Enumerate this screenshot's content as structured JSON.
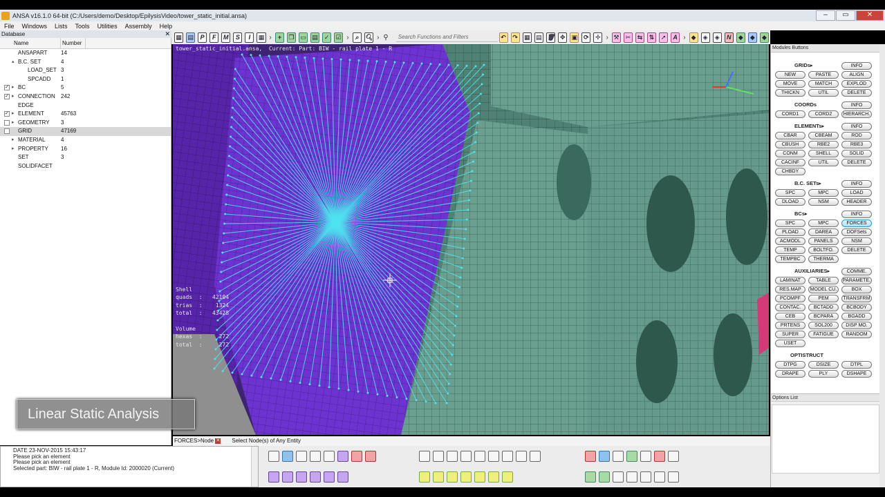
{
  "window": {
    "title": "ANSA v16.1.0 64-bit (C:/Users/demo/Desktop/EpilysisVideo/tower_static_initial.ansa)",
    "controls": [
      "–",
      "▭",
      "✕"
    ]
  },
  "menu": [
    "File",
    "Windows",
    "Lists",
    "Tools",
    "Utilities",
    "Assembly",
    "Help"
  ],
  "search": {
    "placeholder": "Search Functions and Filters"
  },
  "database": {
    "panel_title": "Database",
    "columns": [
      "Name",
      "Number"
    ],
    "rows": [
      {
        "name": "ANSAPART",
        "number": "14",
        "checked": null,
        "arrow": "",
        "indent": 1
      },
      {
        "name": "B.C. SET",
        "number": "4",
        "checked": null,
        "arrow": "▴",
        "indent": 1
      },
      {
        "name": "LOAD_SET",
        "number": "3",
        "checked": null,
        "arrow": "",
        "indent": 2
      },
      {
        "name": "SPCADD",
        "number": "1",
        "checked": null,
        "arrow": "",
        "indent": 2
      },
      {
        "name": "BC",
        "number": "5",
        "checked": true,
        "arrow": "▸",
        "indent": 1
      },
      {
        "name": "CONNECTION",
        "number": "242",
        "checked": true,
        "arrow": "▸",
        "indent": 1
      },
      {
        "name": "EDGE",
        "number": "",
        "checked": null,
        "arrow": "",
        "indent": 1
      },
      {
        "name": "ELEMENT",
        "number": "45763",
        "checked": true,
        "arrow": "▸",
        "indent": 1
      },
      {
        "name": "GEOMETRY",
        "number": "3",
        "checked": false,
        "arrow": "▸",
        "indent": 1
      },
      {
        "name": "GRID",
        "number": "47169",
        "checked": false,
        "arrow": "",
        "indent": 1,
        "selected": true
      },
      {
        "name": "MATERIAL",
        "number": "4",
        "checked": null,
        "arrow": "▸",
        "indent": 1
      },
      {
        "name": "PROPERTY",
        "number": "16",
        "checked": null,
        "arrow": "▸",
        "indent": 1
      },
      {
        "name": "SET",
        "number": "3",
        "checked": null,
        "arrow": "",
        "indent": 1
      },
      {
        "name": "SOLIDFACET",
        "number": "",
        "checked": null,
        "arrow": "",
        "indent": 1
      }
    ]
  },
  "viewport": {
    "header": "tower_static_initial.ansa,  Current: Part: BIW - rail plate 1 - R",
    "stats": [
      "Shell",
      "quads  :   42104",
      "trias  :    1324",
      "total  :   43428",
      "",
      "Volume",
      "hexas  :     272",
      "total  :     272"
    ],
    "caption": "Linear Static Analysis"
  },
  "status": {
    "mode": "FORCES>Node",
    "prompt": "Select Node(s) of Any Entity"
  },
  "messages": [
    "DATE 23-NOV-2015  15:43:17",
    "Please pick an element",
    "Please pick an element",
    "Selected part: BIW - rail plate 1 - R, Module Id: 2000020 (Current)"
  ],
  "modules": {
    "panel_title": "Modules Buttons",
    "options_title": "Options List",
    "sections": [
      {
        "title": "GRIDs▸",
        "buttons": [
          "INFO",
          "NEW",
          "PASTE",
          "ALIGN",
          "MOVE",
          "MATCH",
          "EXPLOD",
          "THICKN",
          "UTIL",
          "DELETE"
        ]
      },
      {
        "title": "COORDs",
        "buttons": [
          "INFO",
          "CORD1",
          "CORD2",
          "HIERARCH."
        ]
      },
      {
        "title": "ELEMENTs▸",
        "buttons": [
          "INFO",
          "CBAR",
          "CBEAM",
          "ROD",
          "CBUSH",
          "RBE2",
          "RBE3",
          "CONM",
          "SHELL",
          "SOLID",
          "CACINF",
          "UTIL",
          "DELETE",
          "CHBDY"
        ]
      },
      {
        "title": "B.C. SETs▸",
        "buttons": [
          "INFO",
          "SPC",
          "MPC",
          "LOAD",
          "DLOAD",
          "NSM",
          "HEADER"
        ]
      },
      {
        "title": "BCs▸",
        "buttons": [
          "INFO",
          "SPC",
          "MPC",
          "FORCES",
          "PLOAD",
          "DAREA",
          "DOFSets",
          "ACMODL",
          "PANELS",
          "NSM",
          "TEMP",
          "BOLTFO.",
          "DELETE",
          "TEMPBC",
          "THERMA"
        ]
      },
      {
        "title": "AUXILIARIES▸",
        "buttons": [
          "COMME.",
          "LAMINAT",
          "TABLE",
          "PARAMETE.",
          "RES.MAP",
          "MODEL CU.",
          "BOX",
          "PCOMPF",
          "PEM",
          "TRANSFRM",
          "CONTAC.",
          "BCTADD",
          "BCBODY",
          "CEB",
          "BCPARA",
          "BGADD",
          "PRTENS",
          "SOL200",
          "DISP MO.",
          "SUPER",
          "FATIGUE",
          "RANDOM",
          "USET"
        ]
      },
      {
        "title": "OPTISTRUCT",
        "buttons": [
          "DTPG",
          "DSIZE",
          "DTPL",
          "DRAPE",
          "PLY",
          "DSHAPE"
        ]
      }
    ]
  },
  "colors": {
    "mesh_green": "#5f9888",
    "mesh_purple": "#6a2fc8",
    "spider_cyan": "#4fe3f0"
  }
}
